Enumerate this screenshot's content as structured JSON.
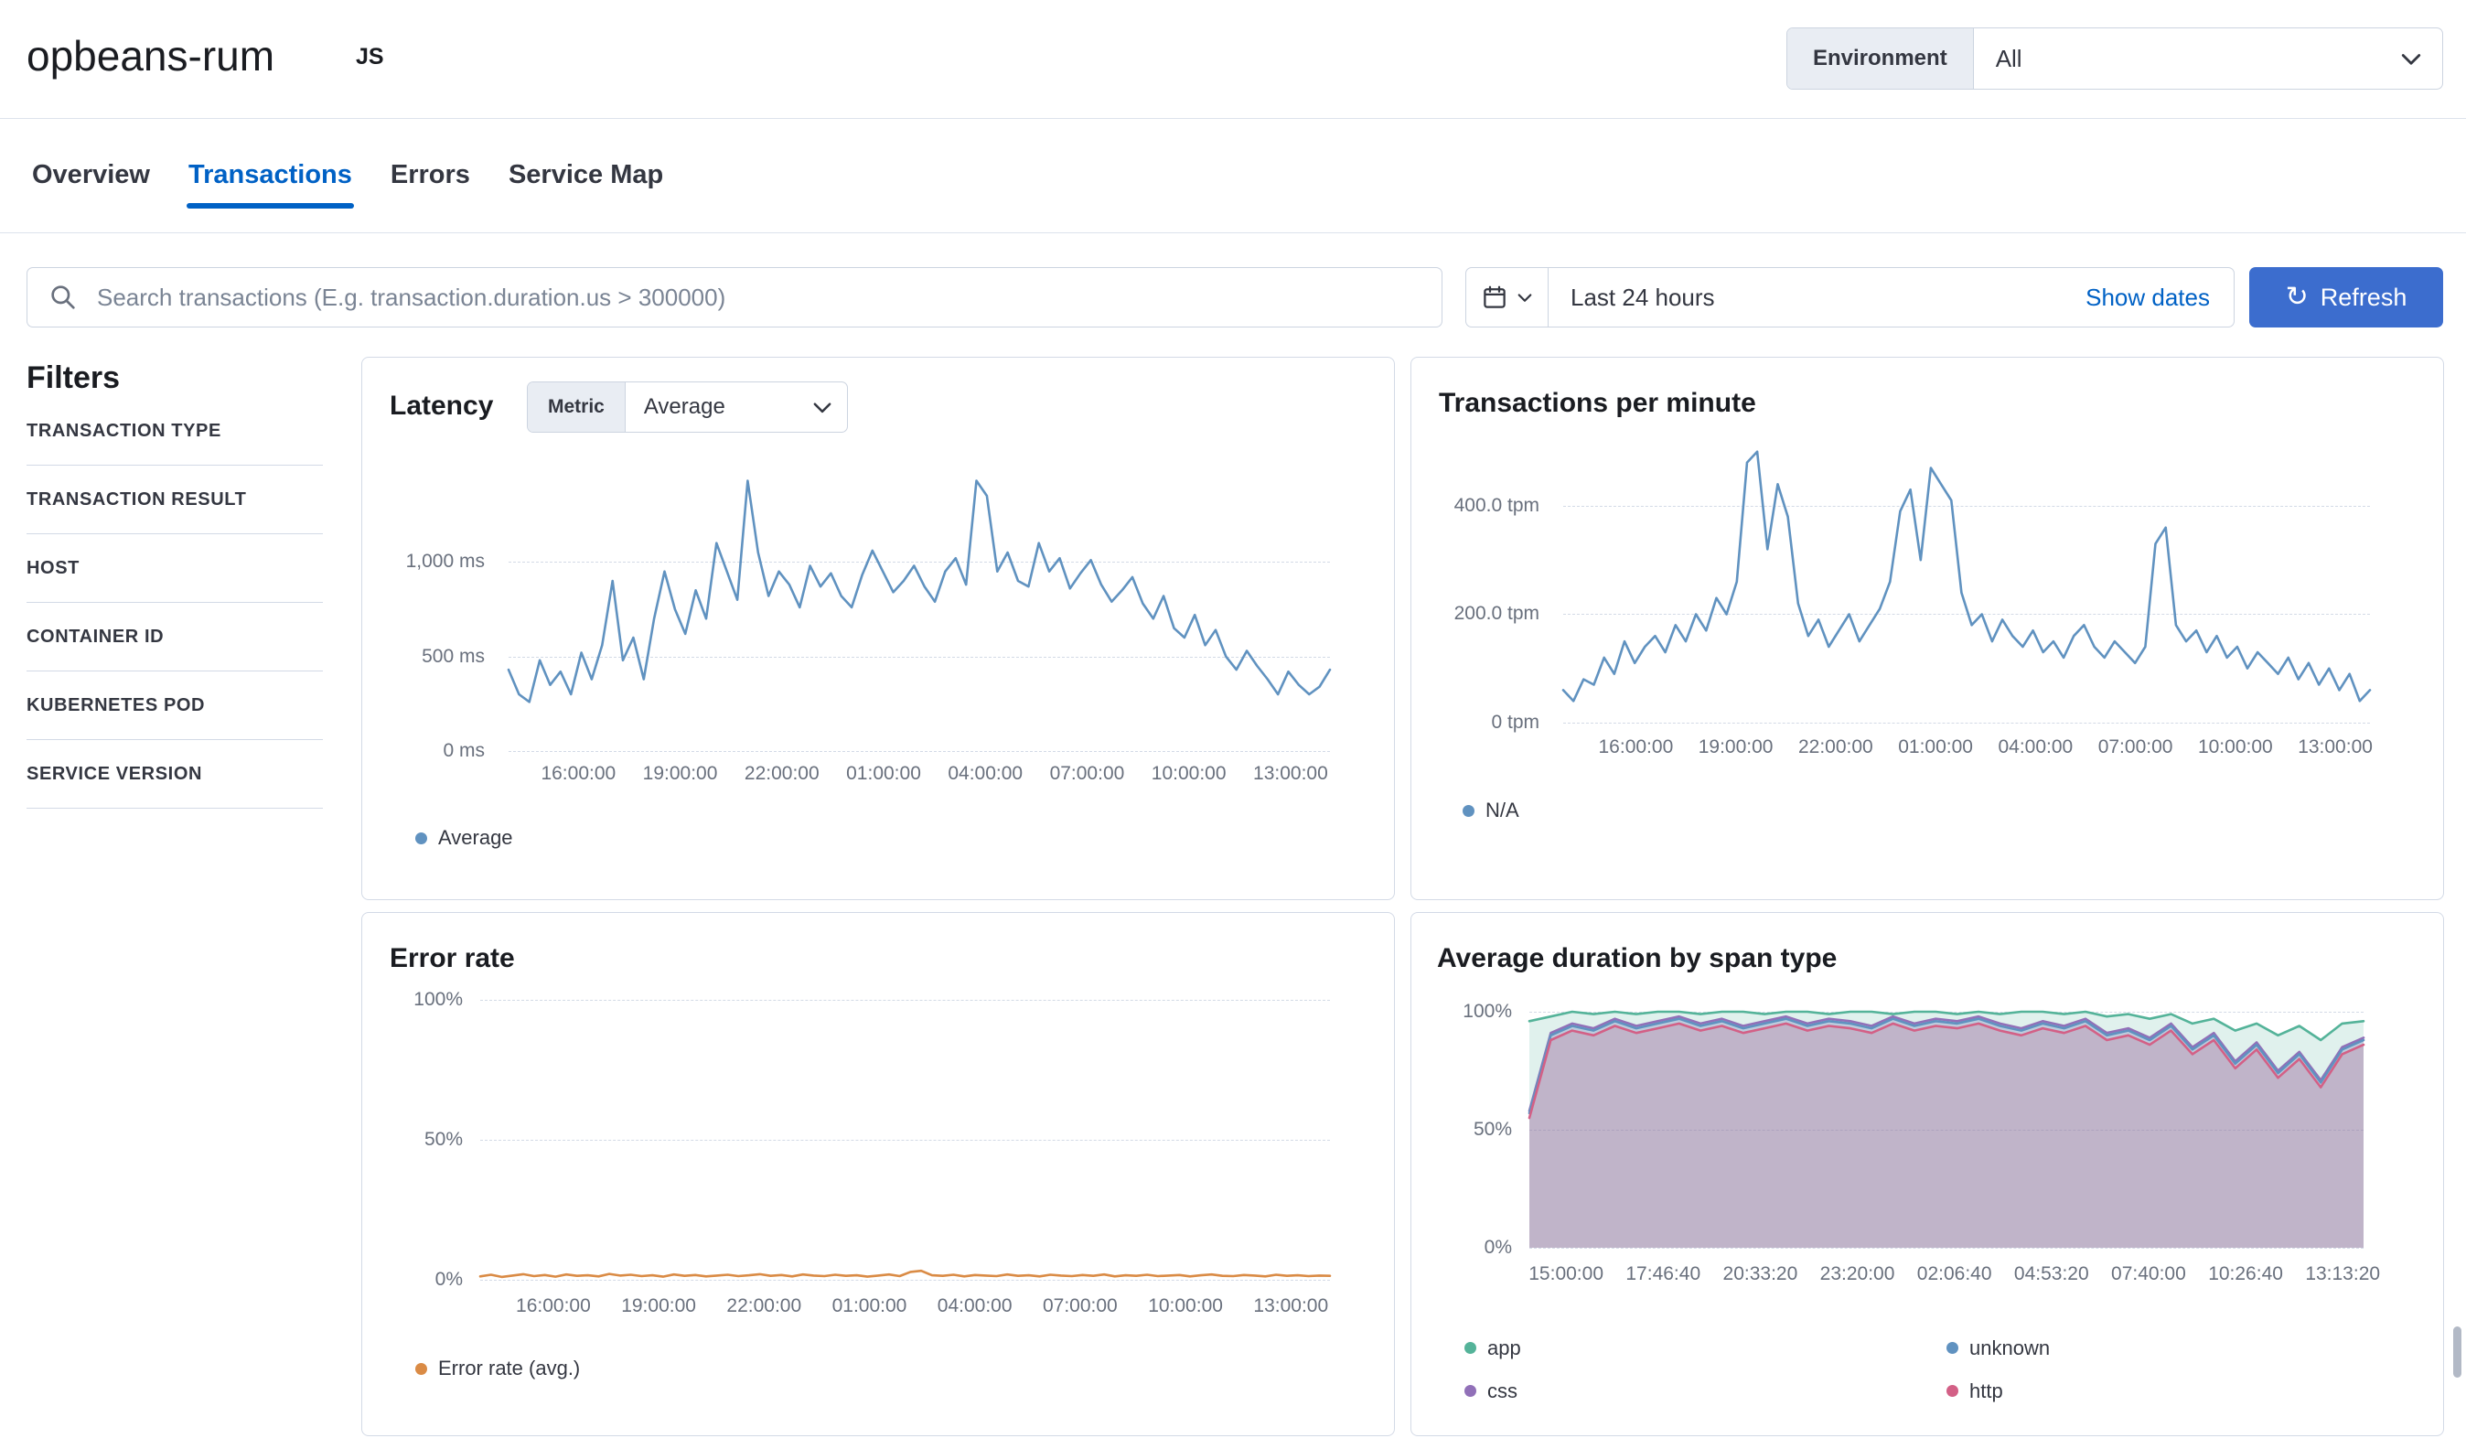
{
  "header": {
    "service_name": "opbeans-rum",
    "agent_badge": "JS",
    "environment_label": "Environment",
    "environment_value": "All"
  },
  "tabs": [
    {
      "label": "Overview"
    },
    {
      "label": "Transactions"
    },
    {
      "label": "Errors"
    },
    {
      "label": "Service Map"
    }
  ],
  "search_bar": {
    "placeholder": "Search transactions (E.g. transaction.duration.us > 300000)",
    "time_range": "Last 24 hours",
    "show_dates": "Show dates",
    "refresh": "Refresh"
  },
  "filters": {
    "heading": "Filters",
    "items": [
      "TRANSACTION TYPE",
      "TRANSACTION RESULT",
      "HOST",
      "CONTAINER ID",
      "KUBERNETES POD",
      "SERVICE VERSION"
    ]
  },
  "colors": {
    "primary_button": "#3c6dce",
    "link": "#0061c5",
    "series_blue": "#6092C0",
    "series_orange": "#DA8B45",
    "series_green": "#54B399",
    "series_purple": "#9170B8",
    "series_pink": "#D36086"
  },
  "chart_data": [
    {
      "type": "line",
      "title": "Latency",
      "metric_label": "Metric",
      "metric_value": "Average",
      "ymin": 0,
      "ymax": 1500,
      "yticks": [
        {
          "value": 0,
          "label": "0 ms"
        },
        {
          "value": 500,
          "label": "500 ms"
        },
        {
          "value": 1000,
          "label": "1,000 ms"
        }
      ],
      "xlabels": [
        "16:00:00",
        "19:00:00",
        "22:00:00",
        "01:00:00",
        "04:00:00",
        "07:00:00",
        "10:00:00",
        "13:00:00"
      ],
      "xstart": 0.085,
      "xend": 0.952,
      "series": [
        {
          "name": "Average",
          "color": "#6092C0",
          "values": [
            430,
            300,
            260,
            480,
            350,
            420,
            300,
            520,
            380,
            560,
            900,
            480,
            600,
            380,
            700,
            950,
            750,
            620,
            850,
            700,
            1100,
            950,
            800,
            1430,
            1050,
            820,
            950,
            880,
            760,
            980,
            870,
            940,
            820,
            760,
            930,
            1060,
            950,
            840,
            900,
            980,
            870,
            790,
            950,
            1020,
            880,
            1430,
            1350,
            950,
            1050,
            900,
            870,
            1100,
            950,
            1020,
            860,
            940,
            1010,
            880,
            790,
            850,
            920,
            780,
            700,
            820,
            650,
            600,
            720,
            560,
            640,
            500,
            430,
            530,
            450,
            380,
            300,
            420,
            350,
            300,
            340,
            430
          ]
        }
      ],
      "legend": [
        {
          "label": "Average",
          "color": "#6092C0"
        }
      ]
    },
    {
      "type": "line",
      "title": "Transactions per minute",
      "ymin": 0,
      "ymax": 513,
      "yticks": [
        {
          "value": 0,
          "label": "0 tpm"
        },
        {
          "value": 200,
          "label": "200.0 tpm"
        },
        {
          "value": 400,
          "label": "400.0 tpm"
        }
      ],
      "xlabels": [
        "16:00:00",
        "19:00:00",
        "22:00:00",
        "01:00:00",
        "04:00:00",
        "07:00:00",
        "10:00:00",
        "13:00:00"
      ],
      "xstart": 0.09,
      "xend": 0.957,
      "series": [
        {
          "name": "N/A",
          "color": "#6092C0",
          "values": [
            60,
            40,
            80,
            70,
            120,
            90,
            150,
            110,
            140,
            160,
            130,
            180,
            150,
            200,
            170,
            230,
            200,
            260,
            480,
            500,
            320,
            440,
            380,
            220,
            160,
            190,
            140,
            170,
            200,
            150,
            180,
            210,
            260,
            390,
            430,
            300,
            470,
            440,
            410,
            240,
            180,
            200,
            150,
            190,
            160,
            140,
            170,
            130,
            150,
            120,
            160,
            180,
            140,
            120,
            150,
            130,
            110,
            140,
            330,
            360,
            180,
            150,
            170,
            130,
            160,
            120,
            140,
            100,
            130,
            110,
            90,
            120,
            80,
            110,
            70,
            100,
            60,
            90,
            40,
            60
          ]
        }
      ],
      "legend": [
        {
          "label": "N/A",
          "color": "#6092C0"
        }
      ]
    },
    {
      "type": "line",
      "title": "Error rate",
      "ymin": 0,
      "ymax": 100,
      "yticks": [
        {
          "value": 0,
          "label": "0%"
        },
        {
          "value": 50,
          "label": "50%"
        },
        {
          "value": 100,
          "label": "100%"
        }
      ],
      "xlabels": [
        "16:00:00",
        "19:00:00",
        "22:00:00",
        "01:00:00",
        "04:00:00",
        "07:00:00",
        "10:00:00",
        "13:00:00"
      ],
      "xstart": 0.086,
      "xend": 0.954,
      "series": [
        {
          "name": "Error rate (avg.)",
          "color": "#DA8B45",
          "values": [
            1.2,
            1.8,
            1.0,
            1.5,
            2.0,
            1.3,
            1.7,
            1.1,
            1.9,
            1.4,
            1.6,
            1.2,
            2.1,
            1.5,
            1.8,
            1.3,
            1.6,
            1.1,
            1.9,
            1.4,
            1.7,
            1.2,
            1.5,
            1.8,
            1.3,
            1.6,
            2.0,
            1.4,
            1.7,
            1.2,
            1.9,
            1.5,
            1.3,
            1.8,
            1.4,
            1.6,
            1.1,
            1.5,
            1.9,
            1.3,
            2.8,
            3.2,
            1.6,
            1.4,
            1.8,
            1.2,
            1.7,
            1.5,
            1.3,
            1.9,
            1.4,
            1.6,
            1.2,
            1.8,
            1.5,
            1.3,
            1.7,
            1.4,
            1.9,
            1.2,
            1.6,
            1.4,
            1.8,
            1.3,
            1.5,
            1.7,
            1.2,
            1.6,
            1.9,
            1.4,
            1.3,
            1.7,
            1.5,
            1.2,
            1.8,
            1.4,
            1.6,
            1.3,
            1.5,
            1.4
          ]
        }
      ],
      "legend": [
        {
          "label": "Error rate (avg.)",
          "color": "#DA8B45"
        }
      ]
    },
    {
      "type": "area",
      "title": "Average duration by span type",
      "ymin": 0,
      "ymax": 100,
      "yticks": [
        {
          "value": 0,
          "label": "0%"
        },
        {
          "value": 50,
          "label": "50%"
        },
        {
          "value": 100,
          "label": "100%"
        }
      ],
      "xlabels": [
        "15:00:00",
        "17:46:40",
        "20:33:20",
        "23:20:00",
        "02:06:40",
        "04:53:20",
        "07:40:00",
        "10:26:40",
        "13:13:20"
      ],
      "xstart": 0.044,
      "xend": 0.975,
      "series": [
        {
          "name": "app",
          "color": "#54B399",
          "fill": "rgba(84,179,153,0.18)",
          "values": [
            96,
            98,
            100,
            99,
            100,
            99,
            100,
            100,
            99,
            100,
            100,
            99,
            100,
            100,
            99,
            100,
            100,
            99,
            100,
            100,
            99,
            100,
            99,
            100,
            100,
            99,
            100,
            98,
            99,
            97,
            99,
            95,
            97,
            92,
            95,
            90,
            94,
            88,
            95,
            96
          ]
        },
        {
          "name": "css",
          "color": "#9170B8",
          "fill": "rgba(145,112,184,0.18)",
          "values": [
            58,
            91,
            95,
            93,
            97,
            94,
            96,
            98,
            95,
            97,
            94,
            96,
            98,
            95,
            97,
            96,
            94,
            98,
            95,
            97,
            96,
            98,
            95,
            93,
            96,
            94,
            97,
            91,
            93,
            89,
            95,
            85,
            91,
            79,
            87,
            75,
            83,
            71,
            85,
            89
          ]
        },
        {
          "name": "unknown",
          "color": "#6092C0",
          "fill": "rgba(96,146,192,0.18)",
          "values": [
            57,
            90,
            94,
            92,
            96,
            93,
            95,
            97,
            94,
            96,
            93,
            95,
            97,
            94,
            96,
            95,
            93,
            97,
            94,
            96,
            95,
            97,
            94,
            92,
            95,
            93,
            96,
            90,
            92,
            88,
            94,
            84,
            90,
            78,
            86,
            74,
            82,
            70,
            84,
            88
          ]
        },
        {
          "name": "http",
          "color": "#D36086",
          "fill": "rgba(211,96,134,0.22)",
          "values": [
            55,
            88,
            92,
            90,
            94,
            91,
            93,
            95,
            92,
            94,
            91,
            93,
            95,
            92,
            94,
            93,
            91,
            95,
            92,
            94,
            93,
            95,
            92,
            90,
            93,
            91,
            94,
            88,
            90,
            86,
            92,
            82,
            88,
            76,
            84,
            72,
            80,
            68,
            82,
            86
          ]
        }
      ],
      "legend": [
        {
          "label": "app",
          "color": "#54B399"
        },
        {
          "label": "css",
          "color": "#9170B8"
        },
        {
          "label": "unknown",
          "color": "#6092C0"
        },
        {
          "label": "http",
          "color": "#D36086"
        }
      ]
    }
  ]
}
